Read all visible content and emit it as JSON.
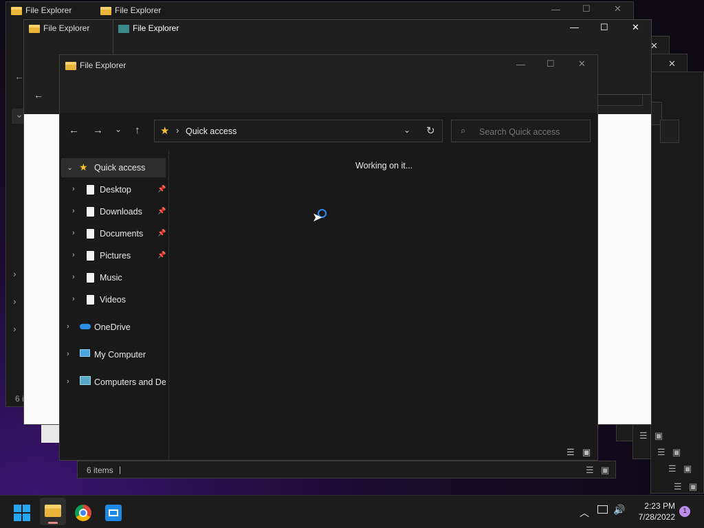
{
  "window_title": "File Explorer",
  "nav": {
    "back_icon": "arrow-left-icon",
    "forward_icon": "arrow-right-icon",
    "recent_icon": "chevron-down-icon",
    "up_icon": "arrow-up-icon"
  },
  "address": {
    "location": "Quick access",
    "separator": "›"
  },
  "search": {
    "placeholder": "Search Quick access"
  },
  "status": {
    "loading_text": "Working on it..."
  },
  "sidebar": {
    "quick_access": "Quick access",
    "items": [
      {
        "label": "Desktop",
        "pinned": true
      },
      {
        "label": "Downloads",
        "pinned": true
      },
      {
        "label": "Documents",
        "pinned": true
      },
      {
        "label": "Pictures",
        "pinned": true
      },
      {
        "label": "Music",
        "pinned": false
      },
      {
        "label": "Videos",
        "pinned": false
      }
    ],
    "onedrive": "OneDrive",
    "my_computer": "My Computer",
    "computers_and_devices": "Computers and Dev"
  },
  "background_windows": {
    "status_left": "6 i",
    "status_items": "6 items",
    "status_sep": "|"
  },
  "taskbar": {
    "time": "2:23 PM",
    "date": "7/28/2022",
    "notification_count": "1"
  },
  "colors": {
    "accent": "#0078d4",
    "folder": "#f5c242",
    "star": "#f4c52f",
    "badge": "#b98ce8"
  }
}
